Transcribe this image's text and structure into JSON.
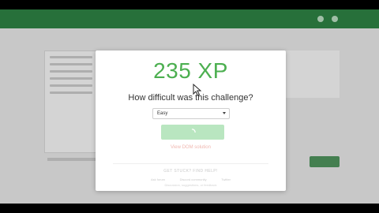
{
  "modal": {
    "xp": "235 XP",
    "question": "How difficult was this challenge?",
    "difficulty_selected": "Easy",
    "view_solution_link": "View DOM solution",
    "help_title": "GET STUCK? FIND HELP!",
    "help_links": [
      "Ask forum",
      "Discord community",
      "Twitter"
    ],
    "help_sub": "Discussion, suggestions, or feedback"
  },
  "colors": {
    "xp_green": "#4caf50",
    "nav_green": "#2b7a3f",
    "submit_button": "#b9e6c0",
    "solution_link": "#f0b7b0"
  },
  "icons": {
    "submit_spinner": "spinner-icon",
    "select_caret": "chevron-down-icon",
    "mouse_cursor": "arrow-cursor-icon"
  }
}
